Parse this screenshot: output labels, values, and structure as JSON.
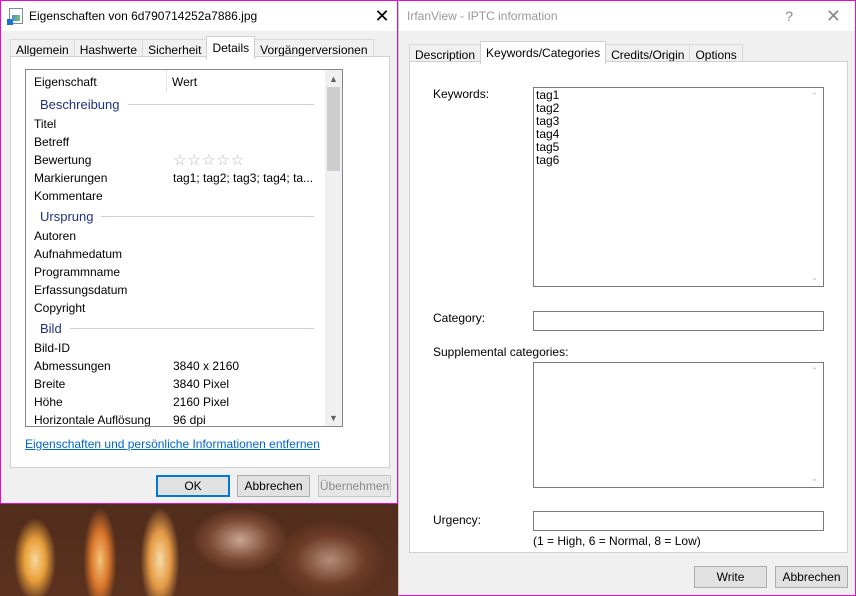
{
  "properties_dialog": {
    "title": "Eigenschaften von 6d790714252a7886.jpg",
    "close_glyph": "✕",
    "tabs": [
      {
        "label": "Allgemein",
        "active": false
      },
      {
        "label": "Hashwerte",
        "active": false
      },
      {
        "label": "Sicherheit",
        "active": false
      },
      {
        "label": "Details",
        "active": true
      },
      {
        "label": "Vorgängerversionen",
        "active": false
      }
    ],
    "list_header": {
      "property": "Eigenschaft",
      "value": "Wert"
    },
    "groups": [
      {
        "name": "Beschreibung",
        "rows": [
          {
            "key": "Titel",
            "value": ""
          },
          {
            "key": "Betreff",
            "value": ""
          },
          {
            "key": "Bewertung",
            "value": "☆☆☆☆☆"
          },
          {
            "key": "Markierungen",
            "value": "tag1; tag2; tag3; tag4; ta..."
          },
          {
            "key": "Kommentare",
            "value": ""
          }
        ]
      },
      {
        "name": "Ursprung",
        "rows": [
          {
            "key": "Autoren",
            "value": ""
          },
          {
            "key": "Aufnahmedatum",
            "value": ""
          },
          {
            "key": "Programmname",
            "value": ""
          },
          {
            "key": "Erfassungsdatum",
            "value": ""
          },
          {
            "key": "Copyright",
            "value": ""
          }
        ]
      },
      {
        "name": "Bild",
        "rows": [
          {
            "key": "Bild-ID",
            "value": ""
          },
          {
            "key": "Abmessungen",
            "value": "3840 x 2160"
          },
          {
            "key": "Breite",
            "value": "3840 Pixel"
          },
          {
            "key": "Höhe",
            "value": "2160 Pixel"
          },
          {
            "key": "Horizontale Auflösung",
            "value": "96 dpi"
          }
        ]
      }
    ],
    "rating_stars_filled": 0,
    "rating_stars_total": 5,
    "remove_link": "Eigenschaften und persönliche Informationen entfernen",
    "buttons": {
      "ok": "OK",
      "cancel": "Abbrechen",
      "apply": "Übernehmen"
    }
  },
  "iptc_dialog": {
    "title": "IrfanView - IPTC information",
    "help_glyph": "?",
    "close_glyph": "✕",
    "tabs": [
      {
        "label": "Description",
        "active": false
      },
      {
        "label": "Keywords/Categories",
        "active": true
      },
      {
        "label": "Credits/Origin",
        "active": false
      },
      {
        "label": "Options",
        "active": false
      }
    ],
    "keywords_label": "Keywords:",
    "keywords": [
      "tag1",
      "tag2",
      "tag3",
      "tag4",
      "tag5",
      "tag6"
    ],
    "category_label": "Category:",
    "category_value": "",
    "supplemental_label": "Supplemental categories:",
    "supplemental_value": "",
    "urgency_label": "Urgency:",
    "urgency_value": "",
    "urgency_hint": "(1 = High, 6 = Normal, 8 = Low)",
    "buttons": {
      "write": "Write",
      "cancel": "Abbrechen"
    }
  },
  "colors": {
    "accent_border": "#e20cd0",
    "group_header": "#1e3287",
    "link": "#0066cc",
    "default_button_border": "#0078d7"
  }
}
